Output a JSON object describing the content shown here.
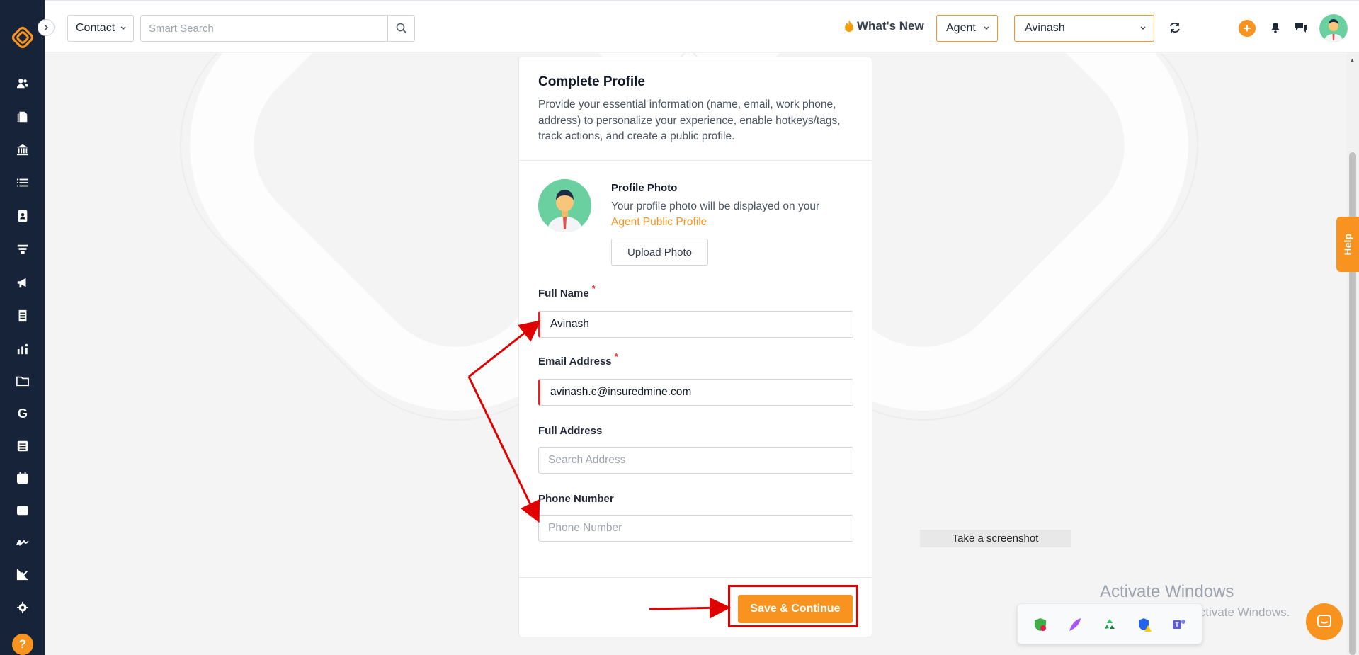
{
  "topbar": {
    "contact_select": "Contact",
    "search_placeholder": "Smart Search",
    "whats_new": "What's New",
    "agent_select": "Agent",
    "user_select": "Avinash"
  },
  "card": {
    "title": "Complete Profile",
    "description": "Provide your essential information (name, email, work phone, address) to personalize your experience, enable hotkeys/tags, track actions, and create a public profile.",
    "photo": {
      "title": "Profile Photo",
      "description": "Your profile photo will be displayed on your",
      "link": "Agent Public Profile",
      "upload_label": "Upload Photo"
    },
    "fields": {
      "full_name": {
        "label": "Full Name",
        "value": "Avinash",
        "required": "*"
      },
      "email": {
        "label": "Email Address",
        "value": "avinash.c@insuredmine.com",
        "required": "*"
      },
      "address": {
        "label": "Full Address",
        "placeholder": "Search Address"
      },
      "phone": {
        "label": "Phone Number",
        "placeholder": "Phone Number"
      }
    },
    "save_label": "Save & Continue"
  },
  "overlay": {
    "screenshot_tip": "Take a screenshot",
    "activate_title": "Activate Windows",
    "activate_sub": "Go to Settings to activate Windows.",
    "help_tab": "Help"
  },
  "colors": {
    "accent": "#f7931e",
    "sidebar": "#172338",
    "required": "#dc2626",
    "annotation": "#e00000"
  },
  "sidebar": {
    "icons": [
      "contacts-icon",
      "documents-icon",
      "bank-icon",
      "list-icon",
      "address-book-icon",
      "funnel-icon",
      "megaphone-icon",
      "report-icon",
      "analytics-icon",
      "folder-icon",
      "google-icon",
      "spreadsheet-icon",
      "calendar-icon",
      "mail-icon",
      "signature-icon",
      "chart-icon",
      "settings-icon"
    ]
  }
}
